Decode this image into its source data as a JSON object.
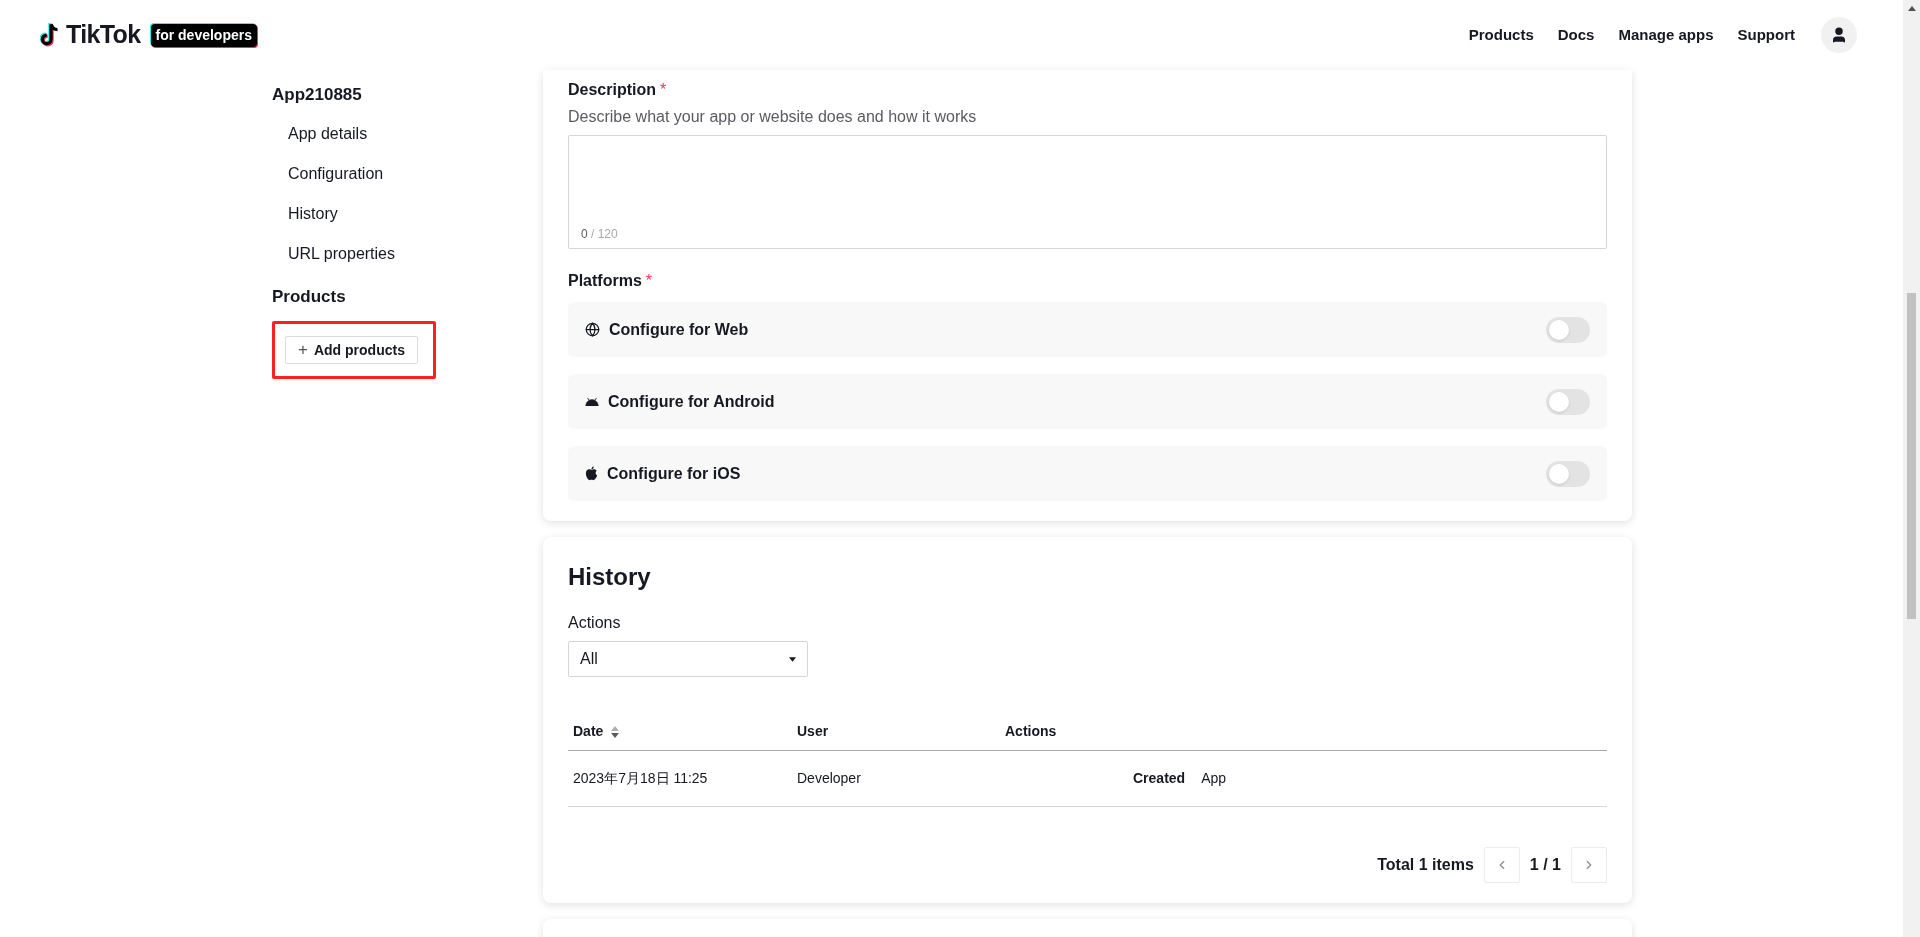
{
  "header": {
    "logo_text": "TikTok",
    "logo_badge": "for developers",
    "nav": [
      "Products",
      "Docs",
      "Manage apps",
      "Support"
    ]
  },
  "sidebar": {
    "app_name": "App210885",
    "items": [
      "App details",
      "Configuration",
      "History",
      "URL properties"
    ],
    "products_title": "Products",
    "add_button": {
      "icon": "+",
      "label": "Add products",
      "highlighted": true
    }
  },
  "description": {
    "label": "Description",
    "required_mark": "*",
    "hint": "Describe what your app or website does and how it works",
    "count": "0",
    "limit": "/ 120"
  },
  "platforms": {
    "label": "Platforms",
    "required_mark": "*",
    "items": [
      {
        "kind": "web",
        "label": "Configure for Web",
        "on": false
      },
      {
        "kind": "android",
        "label": "Configure for Android",
        "on": false
      },
      {
        "kind": "ios",
        "label": "Configure for iOS",
        "on": false
      }
    ]
  },
  "history": {
    "title": "History",
    "filter_label": "Actions",
    "filter_value": "All",
    "columns": [
      "Date",
      "User",
      "Actions"
    ],
    "rows": [
      {
        "date": "2023年7月18日 11:25",
        "user": "Developer",
        "action": "Created",
        "target": "App"
      }
    ],
    "total": "Total 1 items",
    "page": "1 / 1"
  }
}
